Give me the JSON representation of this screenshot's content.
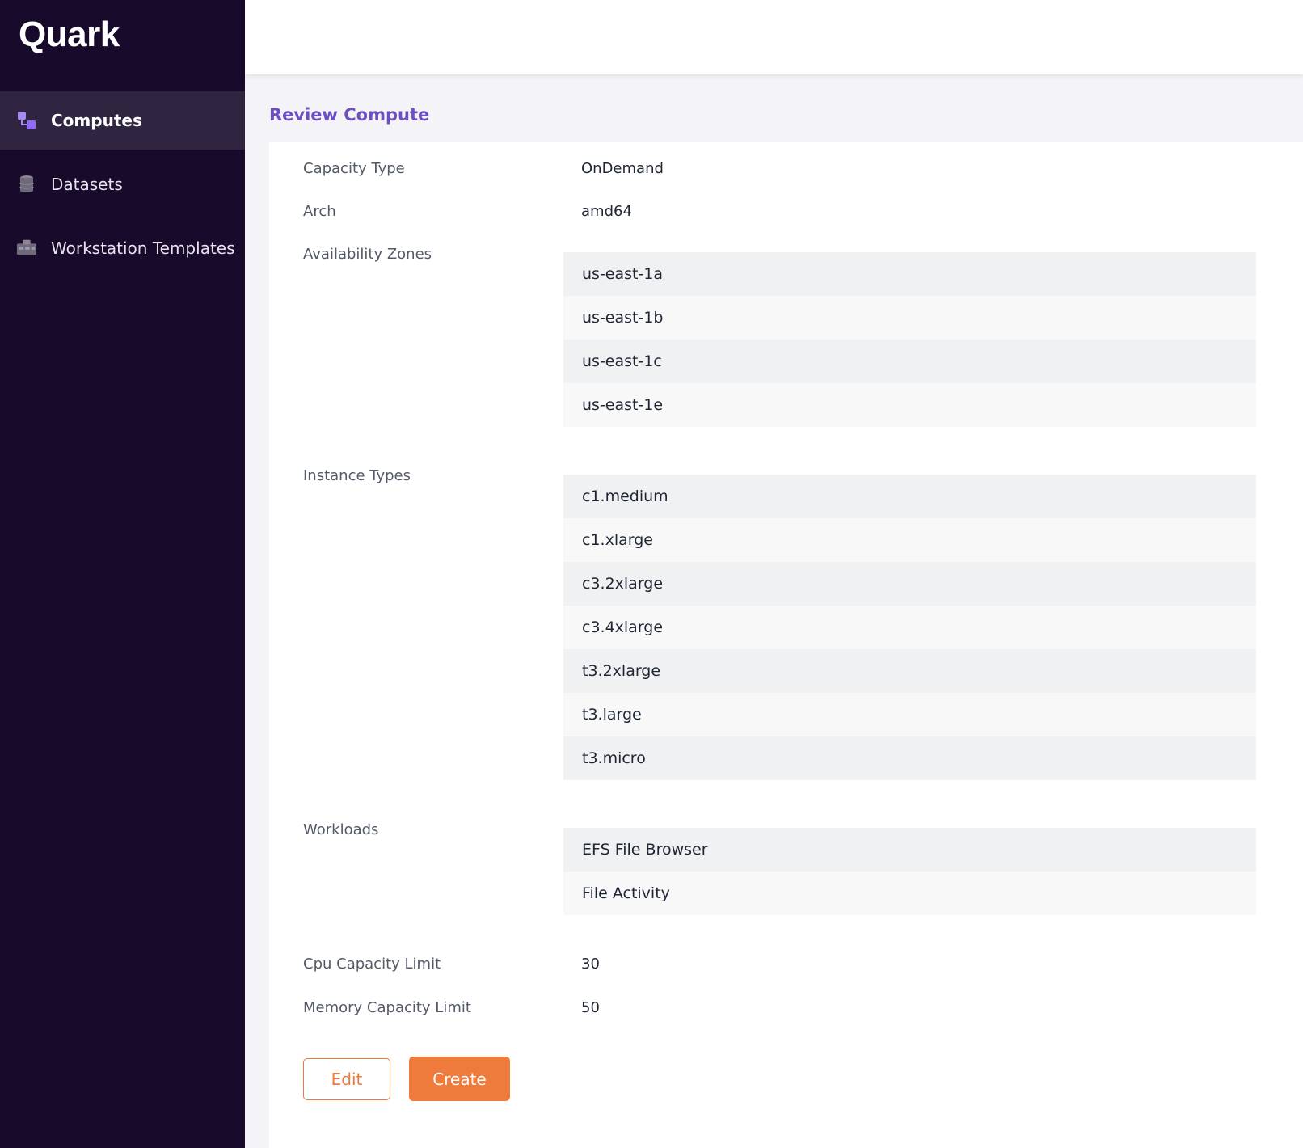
{
  "sidebar": {
    "logo": "Quark",
    "items": [
      {
        "label": "Computes",
        "icon": "computes-icon",
        "active": true
      },
      {
        "label": "Datasets",
        "icon": "database-icon",
        "active": false
      },
      {
        "label": "Workstation Templates",
        "icon": "workstation-templates-icon",
        "active": false
      }
    ]
  },
  "page": {
    "title": "Review Compute"
  },
  "review": {
    "capacity_type": {
      "label": "Capacity Type",
      "value": "OnDemand"
    },
    "arch": {
      "label": "Arch",
      "value": "amd64"
    },
    "availability_zones": {
      "label": "Availability Zones",
      "items": [
        "us-east-1a",
        "us-east-1b",
        "us-east-1c",
        "us-east-1e"
      ]
    },
    "instance_types": {
      "label": "Instance Types",
      "items": [
        "c1.medium",
        "c1.xlarge",
        "c3.2xlarge",
        "c3.4xlarge",
        "t3.2xlarge",
        "t3.large",
        "t3.micro"
      ]
    },
    "workloads": {
      "label": "Workloads",
      "items": [
        "EFS File Browser",
        "File Activity"
      ]
    },
    "cpu_capacity_limit": {
      "label": "Cpu Capacity Limit",
      "value": "30"
    },
    "memory_capacity_limit": {
      "label": "Memory Capacity Limit",
      "value": "50"
    }
  },
  "actions": {
    "edit_label": "Edit",
    "create_label": "Create"
  },
  "colors": {
    "sidebar_bg": "#170a2b",
    "sidebar_active_bg": "#302540",
    "accent_purple": "#6d4fc2",
    "accent_orange": "#ee7b3c"
  }
}
